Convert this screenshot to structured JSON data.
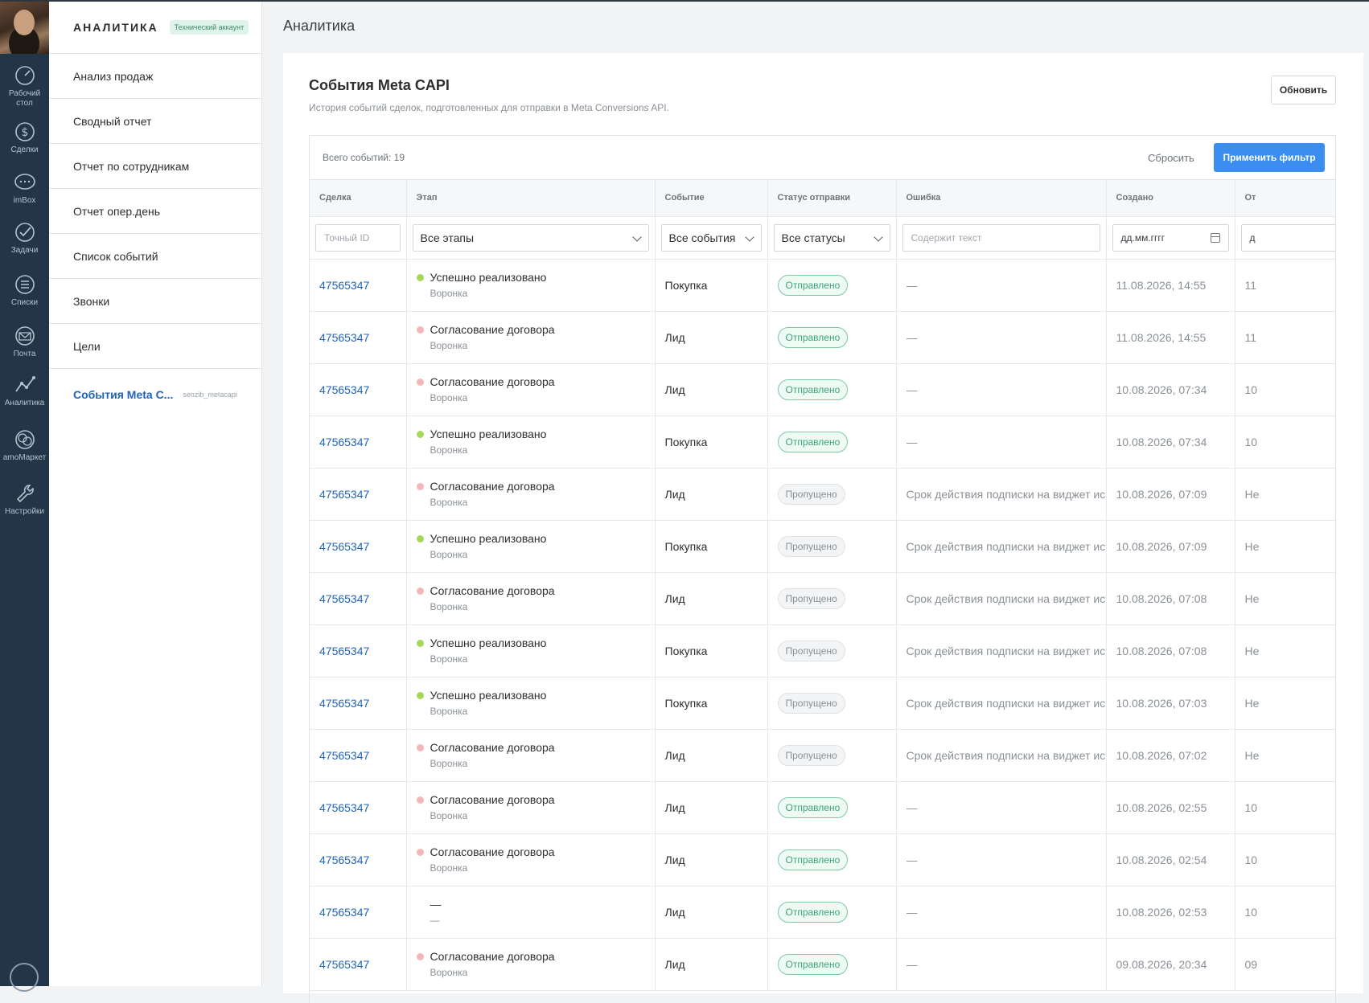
{
  "sidebar": {
    "items": [
      {
        "label": "Рабочий стол",
        "icon": "dashboard-icon"
      },
      {
        "label": "Сделки",
        "icon": "dollar-icon"
      },
      {
        "label": "imBox",
        "icon": "chat-icon"
      },
      {
        "label": "Задачи",
        "icon": "check-icon"
      },
      {
        "label": "Списки",
        "icon": "list-icon"
      },
      {
        "label": "Почта",
        "icon": "mail-icon"
      },
      {
        "label": "Аналитика",
        "icon": "analytics-icon"
      },
      {
        "label": "amoМаркет",
        "icon": "market-icon"
      },
      {
        "label": "Настройки",
        "icon": "wrench-icon"
      }
    ]
  },
  "subnav": {
    "brand": "АНАЛИТИКА",
    "badge": "Технический аккаунт",
    "items": [
      "Анализ продаж",
      "Сводный отчет",
      "Отчет по сотрудникам",
      "Отчет опер.день",
      "Список событий",
      "Звонки",
      "Цели"
    ],
    "active": {
      "label": "События Meta C...",
      "tag": "senzib_metacapi"
    }
  },
  "page": {
    "title": "Аналитика"
  },
  "card": {
    "title": "События Meta CAPI",
    "subtitle": "История событий сделок, подготовленных для отправки в Meta Conversions API.",
    "refresh_label": "Обновить"
  },
  "toolbar": {
    "count": "Всего событий: 19",
    "reset": "Сбросить",
    "apply": "Применить фильтр"
  },
  "columns": [
    "Сделка",
    "Этап",
    "Событие",
    "Статус отправки",
    "Ошибка",
    "Создано",
    "От"
  ],
  "filters": {
    "deal_placeholder": "Точный ID",
    "stage": "Все этапы",
    "event": "Все события",
    "status": "Все статусы",
    "error_placeholder": "Содержит текст",
    "date_placeholder": "дд.мм.гггг",
    "date2_placeholder": "д"
  },
  "colors": {
    "won": "#a6d85a",
    "pending": "#f2b8b8",
    "accent": "#3b8ef0"
  },
  "rows": [
    {
      "deal": "47565347",
      "stage": "Успешно реализовано",
      "pipeline": "Воронка",
      "stage_color": "won",
      "event": "Покупка",
      "status": "Отправлено",
      "status_kind": "sent",
      "error": "—",
      "created": "11.08.2026, 14:55",
      "last": "11"
    },
    {
      "deal": "47565347",
      "stage": "Согласование договора",
      "pipeline": "Воронка",
      "stage_color": "pending",
      "event": "Лид",
      "status": "Отправлено",
      "status_kind": "sent",
      "error": "—",
      "created": "11.08.2026, 14:55",
      "last": "11"
    },
    {
      "deal": "47565347",
      "stage": "Согласование договора",
      "pipeline": "Воронка",
      "stage_color": "pending",
      "event": "Лид",
      "status": "Отправлено",
      "status_kind": "sent",
      "error": "—",
      "created": "10.08.2026, 07:34",
      "last": "10"
    },
    {
      "deal": "47565347",
      "stage": "Успешно реализовано",
      "pipeline": "Воронка",
      "stage_color": "won",
      "event": "Покупка",
      "status": "Отправлено",
      "status_kind": "sent",
      "error": "—",
      "created": "10.08.2026, 07:34",
      "last": "10"
    },
    {
      "deal": "47565347",
      "stage": "Согласование договора",
      "pipeline": "Воронка",
      "stage_color": "pending",
      "event": "Лид",
      "status": "Пропущено",
      "status_kind": "skip",
      "error": "Срок действия подписки на виджет истёк",
      "created": "10.08.2026, 07:09",
      "last": "Не"
    },
    {
      "deal": "47565347",
      "stage": "Успешно реализовано",
      "pipeline": "Воронка",
      "stage_color": "won",
      "event": "Покупка",
      "status": "Пропущено",
      "status_kind": "skip",
      "error": "Срок действия подписки на виджет истёк",
      "created": "10.08.2026, 07:09",
      "last": "Не"
    },
    {
      "deal": "47565347",
      "stage": "Согласование договора",
      "pipeline": "Воронка",
      "stage_color": "pending",
      "event": "Лид",
      "status": "Пропущено",
      "status_kind": "skip",
      "error": "Срок действия подписки на виджет истёк",
      "created": "10.08.2026, 07:08",
      "last": "Не"
    },
    {
      "deal": "47565347",
      "stage": "Успешно реализовано",
      "pipeline": "Воронка",
      "stage_color": "won",
      "event": "Покупка",
      "status": "Пропущено",
      "status_kind": "skip",
      "error": "Срок действия подписки на виджет истёк",
      "created": "10.08.2026, 07:08",
      "last": "Не"
    },
    {
      "deal": "47565347",
      "stage": "Успешно реализовано",
      "pipeline": "Воронка",
      "stage_color": "won",
      "event": "Покупка",
      "status": "Пропущено",
      "status_kind": "skip",
      "error": "Срок действия подписки на виджет истёк",
      "created": "10.08.2026, 07:03",
      "last": "Не"
    },
    {
      "deal": "47565347",
      "stage": "Согласование договора",
      "pipeline": "Воронка",
      "stage_color": "pending",
      "event": "Лид",
      "status": "Пропущено",
      "status_kind": "skip",
      "error": "Срок действия подписки на виджет истёк",
      "created": "10.08.2026, 07:02",
      "last": "Не"
    },
    {
      "deal": "47565347",
      "stage": "Согласование договора",
      "pipeline": "Воронка",
      "stage_color": "pending",
      "event": "Лид",
      "status": "Отправлено",
      "status_kind": "sent",
      "error": "—",
      "created": "10.08.2026, 02:55",
      "last": "10"
    },
    {
      "deal": "47565347",
      "stage": "Согласование договора",
      "pipeline": "Воронка",
      "stage_color": "pending",
      "event": "Лид",
      "status": "Отправлено",
      "status_kind": "sent",
      "error": "—",
      "created": "10.08.2026, 02:54",
      "last": "10"
    },
    {
      "deal": "47565347",
      "stage": "—",
      "pipeline": "—",
      "stage_color": "",
      "event": "Лид",
      "status": "Отправлено",
      "status_kind": "sent",
      "error": "—",
      "created": "10.08.2026, 02:53",
      "last": "10"
    },
    {
      "deal": "47565347",
      "stage": "Согласование договора",
      "pipeline": "Воронка",
      "stage_color": "pending",
      "event": "Лид",
      "status": "Отправлено",
      "status_kind": "sent",
      "error": "—",
      "created": "09.08.2026, 20:34",
      "last": "09"
    }
  ]
}
